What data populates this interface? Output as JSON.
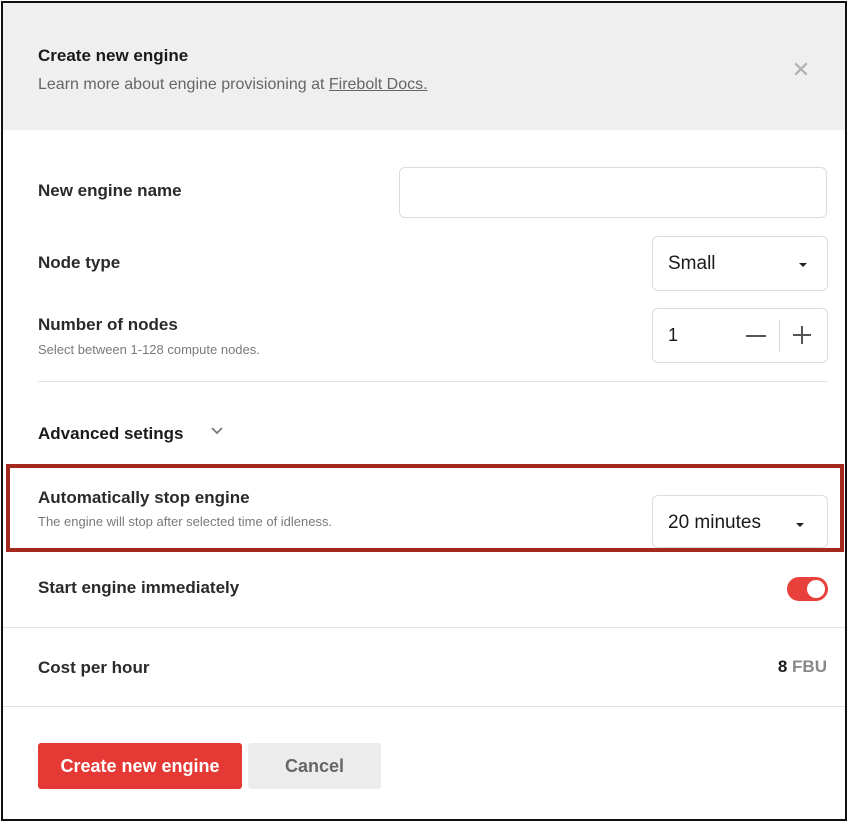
{
  "header": {
    "title": "Create new engine",
    "subtitle_prefix": "Learn more about engine provisioning at ",
    "docs_link": "Firebolt Docs.",
    "close_icon": "close-icon"
  },
  "engine_name": {
    "label": "New engine name",
    "value": ""
  },
  "node_type": {
    "label": "Node type",
    "selected": "Small"
  },
  "nodes": {
    "label": "Number of nodes",
    "hint": "Select between 1-128 compute nodes.",
    "value": "1"
  },
  "advanced": {
    "label": "Advanced setings",
    "icon": "chevron-down-icon"
  },
  "auto_stop": {
    "label": "Automatically stop engine",
    "hint": "The engine will stop after selected time of idleness.",
    "selected": "20 minutes"
  },
  "start_immediately": {
    "label": "Start engine immediately",
    "enabled": true,
    "accent_color": "#e8403a"
  },
  "cost": {
    "label": "Cost per hour",
    "value": "8",
    "unit": "FBU"
  },
  "actions": {
    "create_label": "Create new engine",
    "cancel_label": "Cancel",
    "primary_color": "#e53935"
  }
}
